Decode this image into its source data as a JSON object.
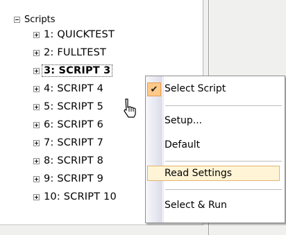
{
  "tree": {
    "root_label": "Scripts",
    "items": [
      {
        "label": "1: QUICKTEST"
      },
      {
        "label": "2: FULLTEST"
      },
      {
        "label": "3: SCRIPT  3"
      },
      {
        "label": "4: SCRIPT  4"
      },
      {
        "label": "5: SCRIPT  5"
      },
      {
        "label": "6: SCRIPT  6"
      },
      {
        "label": "7: SCRIPT  7"
      },
      {
        "label": "8: SCRIPT  8"
      },
      {
        "label": "9: SCRIPT  9"
      },
      {
        "label": "10: SCRIPT  10"
      }
    ]
  },
  "context_menu": {
    "items": [
      {
        "label": "Select Script"
      },
      {
        "label": "Setup..."
      },
      {
        "label": "Default"
      },
      {
        "label": "Read Settings"
      },
      {
        "label": "Select & Run"
      }
    ]
  },
  "colors": {
    "highlight": "#fff5d6",
    "check_bg": "#ffc98a"
  }
}
